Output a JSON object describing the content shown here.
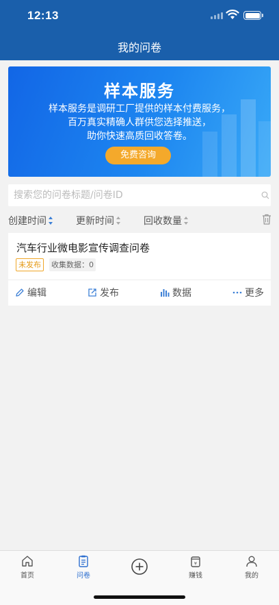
{
  "status_bar": {
    "time": "12:13"
  },
  "nav": {
    "title": "我的问卷"
  },
  "banner": {
    "title": "样本服务",
    "lines": [
      "样本服务是调研工厂提供的样本付费服务，",
      "百万真实精确人群供您选择推送，",
      "助你快速高质回收答卷。"
    ],
    "button": "免费咨询"
  },
  "search": {
    "placeholder": "搜索您的问卷标题/问卷ID"
  },
  "sort": {
    "created": "创建时间",
    "updated": "更新时间",
    "responses": "回收数量"
  },
  "survey": {
    "title": "汽车行业微电影宣传调查问卷",
    "status": "未发布",
    "collected": "收集数据：0",
    "actions": {
      "edit": "编辑",
      "publish": "发布",
      "data": "数据",
      "more": "更多"
    }
  },
  "tabbar": {
    "home": "首页",
    "survey": "问卷",
    "earn": "赚钱",
    "mine": "我的"
  },
  "colors": {
    "primary": "#1a5fab",
    "accent_orange": "#f4a92b",
    "active_tab": "#2d6fcf"
  }
}
